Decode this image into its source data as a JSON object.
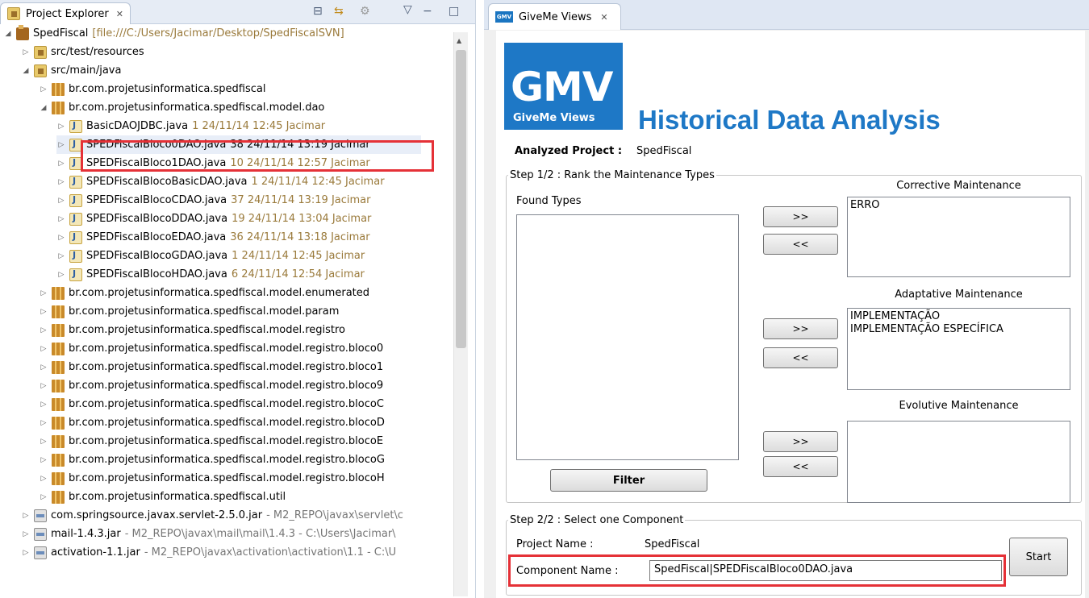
{
  "explorer": {
    "tab_title": "Project Explorer",
    "tab_close": "✕",
    "toolbar": {
      "collapse_icon": "⊟",
      "link_icon": "⇆",
      "filter_icon": "⚙",
      "menu_icon": "▽",
      "minimize_icon": "−",
      "maximize_icon": "□"
    },
    "project": {
      "name": "SpedFiscal",
      "location": "[file:///C:/Users/Jacimar/Desktop/SpedFiscalSVN]"
    },
    "src_test": "src/test/resources",
    "src_main": "src/main/java",
    "pkg_spedfiscal": "br.com.projetusinformatica.spedfiscal",
    "pkg_dao": "br.com.projetusinformatica.spedfiscal.model.dao",
    "dao_files": [
      {
        "name": "BasicDAOJDBC.java",
        "meta": "1  24/11/14 12:45  Jacimar"
      },
      {
        "name": "SPEDFiscalBloco0DAO.java",
        "meta": "38  24/11/14 13:19  Jacimar"
      },
      {
        "name": "SPEDFiscalBloco1DAO.java",
        "meta": "10  24/11/14 12:57  Jacimar"
      },
      {
        "name": "SPEDFiscalBlocoBasicDAO.java",
        "meta": "1  24/11/14 12:45  Jacimar"
      },
      {
        "name": "SPEDFiscalBlocoCDAO.java",
        "meta": "37  24/11/14 13:19  Jacimar"
      },
      {
        "name": "SPEDFiscalBlocoDDAO.java",
        "meta": "19  24/11/14 13:04  Jacimar"
      },
      {
        "name": "SPEDFiscalBlocoEDAO.java",
        "meta": "36  24/11/14 13:18  Jacimar"
      },
      {
        "name": "SPEDFiscalBlocoGDAO.java",
        "meta": "1  24/11/14 12:45  Jacimar"
      },
      {
        "name": "SPEDFiscalBlocoHDAO.java",
        "meta": "6  24/11/14 12:54  Jacimar"
      }
    ],
    "packages": [
      "br.com.projetusinformatica.spedfiscal.model.enumerated",
      "br.com.projetusinformatica.spedfiscal.model.param",
      "br.com.projetusinformatica.spedfiscal.model.registro",
      "br.com.projetusinformatica.spedfiscal.model.registro.bloco0",
      "br.com.projetusinformatica.spedfiscal.model.registro.bloco1",
      "br.com.projetusinformatica.spedfiscal.model.registro.bloco9",
      "br.com.projetusinformatica.spedfiscal.model.registro.blocoC",
      "br.com.projetusinformatica.spedfiscal.model.registro.blocoD",
      "br.com.projetusinformatica.spedfiscal.model.registro.blocoE",
      "br.com.projetusinformatica.spedfiscal.model.registro.blocoG",
      "br.com.projetusinformatica.spedfiscal.model.registro.blocoH",
      "br.com.projetusinformatica.spedfiscal.util"
    ],
    "jars": [
      {
        "name": "com.springsource.javax.servlet-2.5.0.jar",
        "path": "- M2_REPO\\javax\\servlet\\c"
      },
      {
        "name": "mail-1.4.3.jar",
        "path": "- M2_REPO\\javax\\mail\\mail\\1.4.3 - C:\\Users\\Jacimar\\"
      },
      {
        "name": "activation-1.1.jar",
        "path": "- M2_REPO\\javax\\activation\\activation\\1.1 - C:\\U"
      }
    ]
  },
  "giveme": {
    "tab_title": "GiveMe Views",
    "tab_close": "✕",
    "tab_icon_text": "GMV",
    "logo_big": "GMV",
    "logo_small": "GiveMe Views",
    "title": "Historical Data Analysis",
    "analyzed_label": "Analyzed Project :",
    "analyzed_value": "SpedFiscal",
    "step1_label": "Step 1/2 : Rank the Maintenance Types",
    "found_types_label": "Found Types",
    "found_types": [],
    "corrective_label": "Corrective Maintenance",
    "corrective_items": [
      "ERRO"
    ],
    "adaptative_label": "Adaptative Maintenance",
    "adaptative_items": [
      "IMPLEMENTAÇÃO",
      "IMPLEMENTAÇÃO ESPECÍFICA"
    ],
    "evolutive_label": "Evolutive Maintenance",
    "evolutive_items": [],
    "add_label": ">>",
    "remove_label": "<<",
    "filter_label": "Filter",
    "step2_label": "Step 2/2 : Select one Component",
    "project_name_label": "Project Name :",
    "project_name_value": "SpedFiscal",
    "component_name_label": "Component Name :",
    "component_name_value": "SpedFiscal|SPEDFiscalBloco0DAO.java",
    "start_label": "Start"
  }
}
